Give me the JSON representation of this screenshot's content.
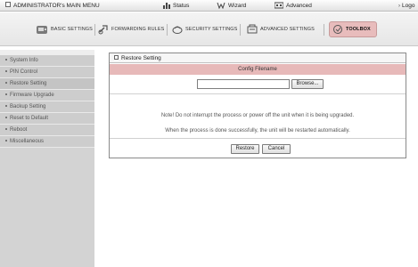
{
  "topbar": {
    "main_menu": "ADMINISTRATOR's MAIN MENU",
    "status": "Status",
    "wizard": "Wizard",
    "advanced": "Advanced",
    "logout": "Logo"
  },
  "tabs": [
    {
      "label": "BASIC SETTINGS",
      "icon": "basic-settings-icon"
    },
    {
      "label": "FORWARDING RULES",
      "icon": "forwarding-rules-icon"
    },
    {
      "label": "SECURITY SETTINGS",
      "icon": "security-settings-icon"
    },
    {
      "label": "ADVANCED SETTINGS",
      "icon": "advanced-settings-icon"
    },
    {
      "label": "TOOLBOX",
      "icon": "toolbox-icon",
      "active": true
    }
  ],
  "sidebar": {
    "items": [
      {
        "label": "System Info"
      },
      {
        "label": "PIN Control"
      },
      {
        "label": "Restore Setting"
      },
      {
        "label": "Firmware Upgrade"
      },
      {
        "label": "Backup Setting"
      },
      {
        "label": "Reset to Default"
      },
      {
        "label": "Reboot"
      },
      {
        "label": "Miscellaneous"
      }
    ]
  },
  "panel": {
    "title": "Restore Setting",
    "config_header": "Config Filename",
    "file_value": "",
    "browse_label": "Browse...",
    "note1": "Note! Do not interrupt the process or power off the unit when it is being upgraded.",
    "note2": "When the process is done successfully, the unit will be restarted automatically.",
    "restore_label": "Restore",
    "cancel_label": "Cancel"
  },
  "colors": {
    "accent_pink": "#e7b9b9",
    "sidebar_bg": "#d3d3d3",
    "active_tab": "#e8bcbc"
  }
}
